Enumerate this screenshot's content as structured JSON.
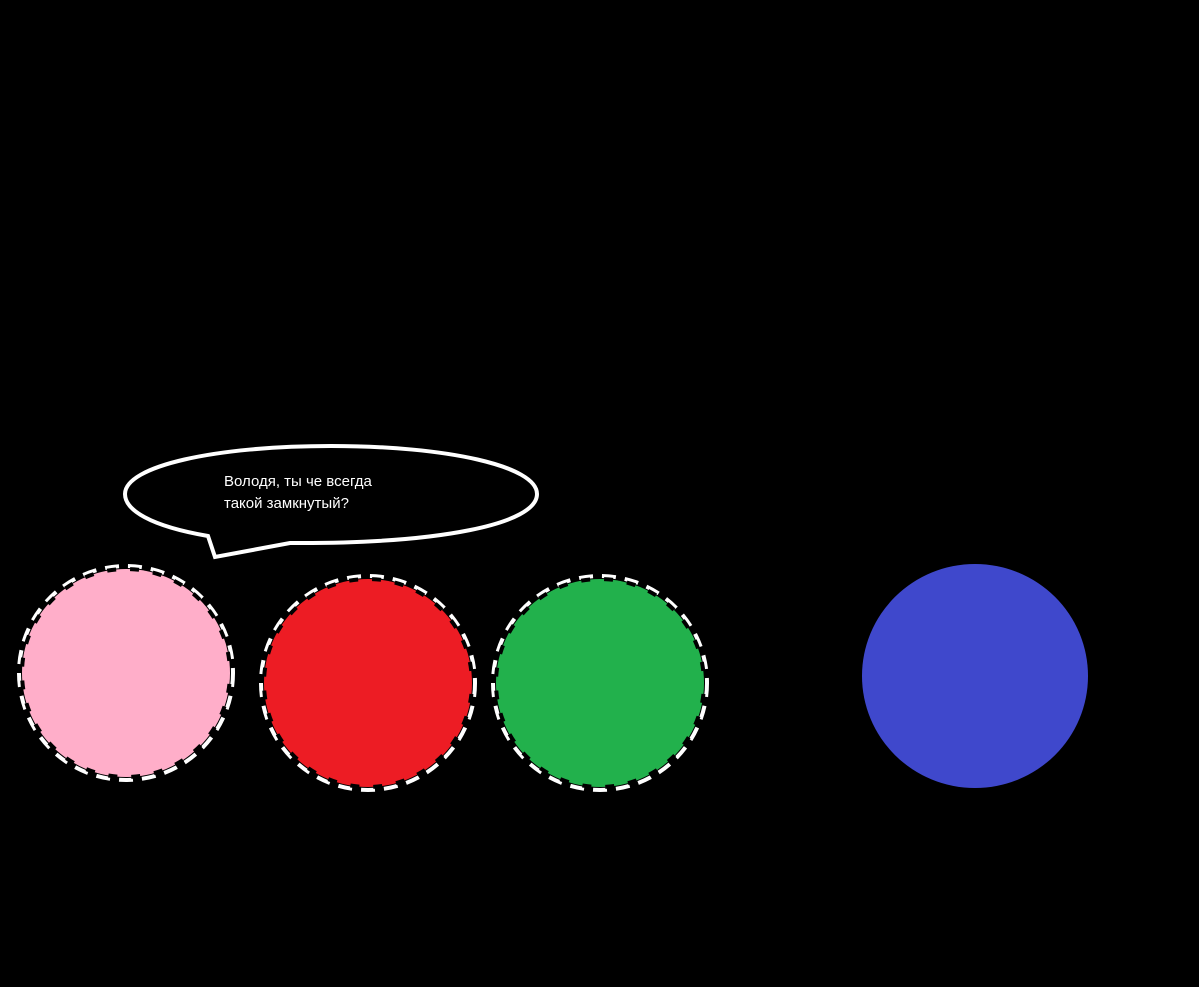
{
  "speech_bubble": {
    "line1": "Володя, ты че всегда",
    "line2": "такой замкнутый?"
  },
  "colors": {
    "background": "#000000",
    "pink": "#ffaec9",
    "red": "#ed1c24",
    "green": "#22b14c",
    "blue": "#3f48cc",
    "outline": "#ffffff",
    "text": "#ffffff"
  }
}
